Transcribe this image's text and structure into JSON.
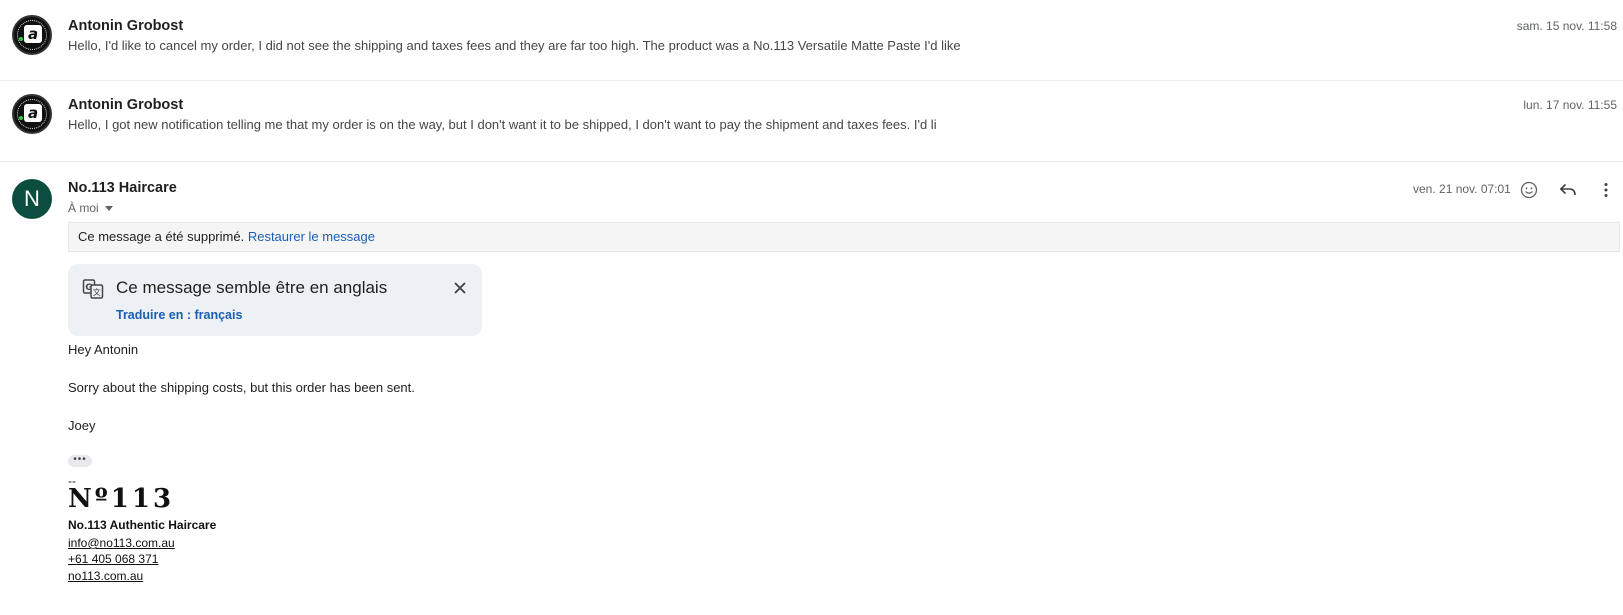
{
  "messages": [
    {
      "sender": "Antonin Grobost",
      "snippet": "Hello, I'd like to cancel my order, I did not see the shipping and taxes fees and they are far too high. The product was a No.113 Versatile Matte Paste I'd like",
      "date": "sam. 15 nov. 11:58"
    },
    {
      "sender": "Antonin Grobost",
      "snippet": "Hello, I got new notification telling me that my order is on the way, but I don't want it to be shipped, I don't want to pay the shipment and taxes fees. I'd li",
      "date": "lun. 17 nov. 11:55"
    }
  ],
  "expanded": {
    "avatar_letter": "N",
    "avatar_color": "#0b4d3f",
    "sender": "No.113 Haircare",
    "recipient": "À moi",
    "date": "ven. 21 nov. 07:01",
    "icons": [
      "emoji-react-icon",
      "reply-icon",
      "more-vert-icon"
    ],
    "deleted_notice": "Ce message a été supprimé.",
    "restore_link": "Restaurer le message",
    "translate": {
      "title": "Ce message semble être en anglais",
      "action": "Traduire en : français"
    },
    "body": {
      "greeting": "Hey Antonin",
      "line1": "Sorry about the shipping costs, but this order has been sent.",
      "signoff": "Joey",
      "ellipsis": "•••"
    },
    "signature": {
      "dash": "--",
      "logo_text": "Nº113",
      "company": "No.113 Authentic Haircare",
      "email": "info@no113.com.au",
      "phone": "+61 405 068 371",
      "website": "no113.com.au"
    }
  }
}
